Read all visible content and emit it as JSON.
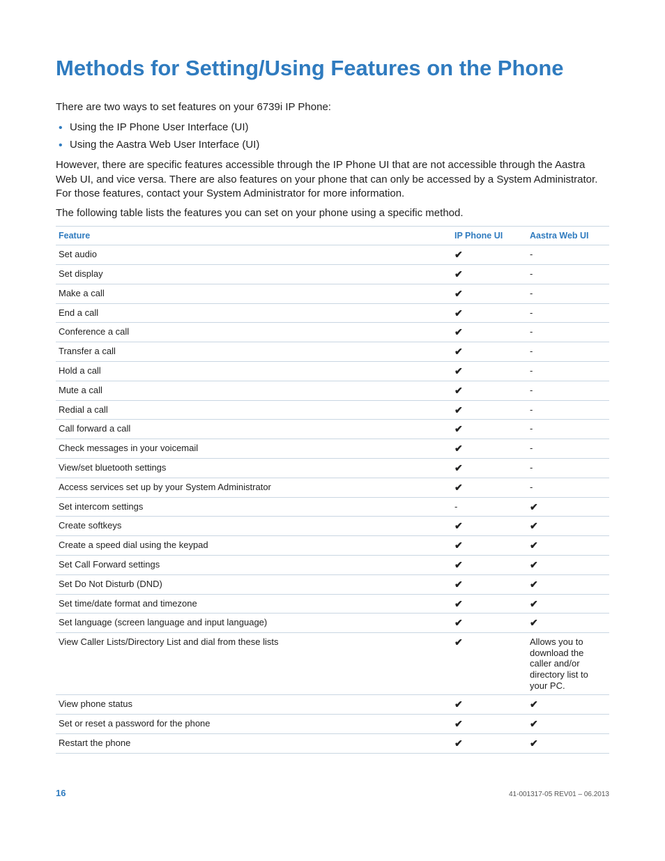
{
  "title": "Methods for Setting/Using Features on the Phone",
  "intro": "There are two ways to set features on your 6739i IP Phone:",
  "bullets": [
    "Using the IP Phone User Interface (UI)",
    "Using the Aastra Web User Interface (UI)"
  ],
  "para_however": "However, there are specific features accessible through the IP Phone UI that are not accessible through the Aastra Web UI, and vice versa. There are also features on your phone that can only be accessed by a System Administrator. For those features, contact your System Administrator for more information.",
  "para_following": "The following table lists the features you can set on your phone using a specific method.",
  "table": {
    "headers": {
      "feature": "Feature",
      "ip": "IP Phone UI",
      "web": "Aastra Web UI"
    },
    "check": "✔",
    "dash": "-",
    "rows": [
      {
        "feature": "Set audio",
        "ip": "✔",
        "web": "-"
      },
      {
        "feature": "Set display",
        "ip": "✔",
        "web": "-"
      },
      {
        "feature": "Make a call",
        "ip": "✔",
        "web": "-"
      },
      {
        "feature": "End a call",
        "ip": "✔",
        "web": "-"
      },
      {
        "feature": "Conference a call",
        "ip": "✔",
        "web": "-"
      },
      {
        "feature": "Transfer a call",
        "ip": "✔",
        "web": "-"
      },
      {
        "feature": "Hold a call",
        "ip": "✔",
        "web": "-"
      },
      {
        "feature": "Mute a call",
        "ip": "✔",
        "web": "-"
      },
      {
        "feature": "Redial a call",
        "ip": "✔",
        "web": "-"
      },
      {
        "feature": "Call forward a call",
        "ip": "✔",
        "web": "-"
      },
      {
        "feature": "Check messages in your voicemail",
        "ip": "✔",
        "web": "-"
      },
      {
        "feature": "View/set bluetooth settings",
        "ip": "✔",
        "web": "-"
      },
      {
        "feature": "Access services set up by your System Administrator",
        "ip": "✔",
        "web": "-"
      },
      {
        "feature": "Set intercom settings",
        "ip": "-",
        "web": "✔"
      },
      {
        "feature": "Create softkeys",
        "ip": "✔",
        "web": "✔"
      },
      {
        "feature": "Create a speed dial using the keypad",
        "ip": "✔",
        "web": "✔"
      },
      {
        "feature": "Set Call Forward settings",
        "ip": "✔",
        "web": "✔"
      },
      {
        "feature": "Set Do Not Disturb (DND)",
        "ip": "✔",
        "web": "✔"
      },
      {
        "feature": "Set time/date format and timezone",
        "ip": "✔",
        "web": "✔"
      },
      {
        "feature": "Set language (screen language and input language)",
        "ip": "✔",
        "web": "✔"
      },
      {
        "feature": "View Caller Lists/Directory List and dial from these lists",
        "ip": "✔",
        "web": "Allows you to download the caller and/or directory list to your PC."
      },
      {
        "feature": "View phone status",
        "ip": "✔",
        "web": "✔"
      },
      {
        "feature": "Set or reset a password for the phone",
        "ip": "✔",
        "web": "✔"
      },
      {
        "feature": "Restart the phone",
        "ip": "✔",
        "web": "✔"
      }
    ]
  },
  "footer": {
    "page": "16",
    "docid": "41-001317-05 REV01 – 06.2013"
  }
}
